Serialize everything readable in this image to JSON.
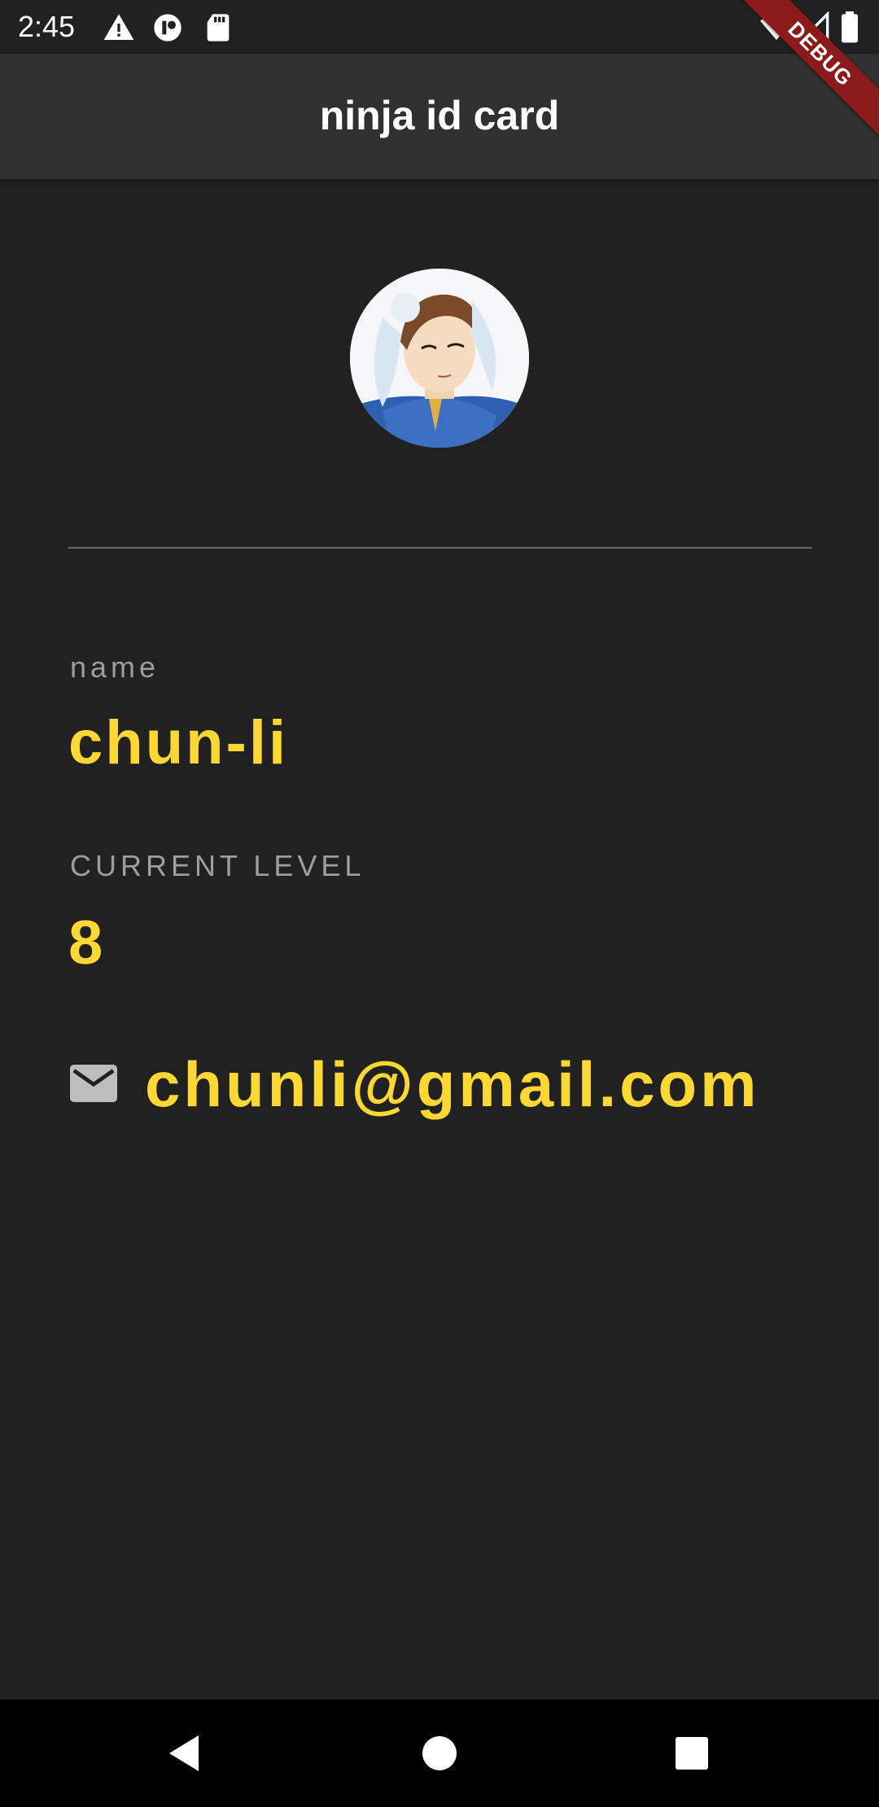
{
  "status_bar": {
    "time": "2:45",
    "left_icons": [
      "warning-icon",
      "vpn-key-icon",
      "sd-card-icon"
    ],
    "right_icons": [
      "wifi-icon",
      "signal-icon",
      "battery-icon"
    ]
  },
  "app_bar": {
    "title": "ninja id card"
  },
  "debug_banner": {
    "label": "DEBUG"
  },
  "profile": {
    "name_label": "name",
    "name_value": "chun-li",
    "level_label": "CURRENT LEVEL",
    "level_value": "8",
    "email": "chunli@gmail.com",
    "email_icon": "mail-icon"
  },
  "nav_bar": {
    "buttons": [
      "back-icon",
      "home-icon",
      "recents-icon"
    ]
  },
  "colors": {
    "background": "#212121",
    "app_bar": "#303030",
    "accent": "#fdd835",
    "label": "#9e9e9e",
    "debug": "#8b1a1a"
  }
}
